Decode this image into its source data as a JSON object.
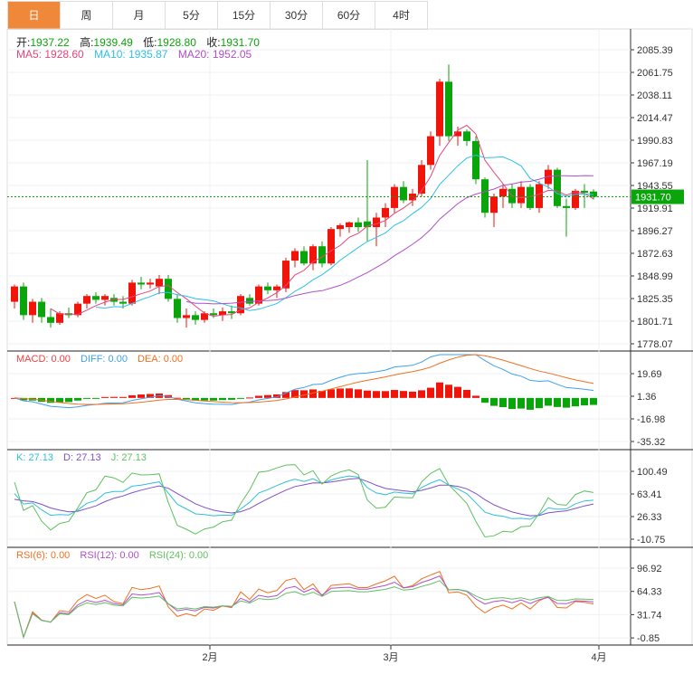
{
  "tabs": [
    {
      "label": "日",
      "active": true
    },
    {
      "label": "周"
    },
    {
      "label": "月"
    },
    {
      "label": "5分"
    },
    {
      "label": "15分"
    },
    {
      "label": "30分"
    },
    {
      "label": "60分"
    },
    {
      "label": "4时"
    }
  ],
  "ohlc_legend": {
    "open_label": "开:",
    "open": "1937.22",
    "high_label": "高:",
    "high": "1939.49",
    "low_label": "低:",
    "low": "1928.80",
    "close_label": "收:",
    "close": "1931.70"
  },
  "ma_legend": {
    "ma5": "MA5: 1928.60",
    "ma10": "MA10: 1935.87",
    "ma20": "MA20: 1952.05"
  },
  "macd_legend": {
    "macd": "MACD: 0.00",
    "diff": "DIFF: 0.00",
    "dea": "DEA: 0.00"
  },
  "kdj_legend": {
    "k": "K: 27.13",
    "d": "D: 27.13",
    "j": "J: 27.13"
  },
  "rsi_legend": {
    "rsi6": "RSI(6): 0.00",
    "rsi12": "RSI(12): 0.00",
    "rsi24": "RSI(24): 0.00"
  },
  "current_price": "1931.70",
  "colors": {
    "up": "#f0140a",
    "down": "#0aa50a",
    "ma5": "#e8457a",
    "ma10": "#2ec0e8",
    "ma20": "#b050c8",
    "tab_active": "#f0883a",
    "dif": "#3fa0f0",
    "dea": "#f07020",
    "k": "#30c0d8",
    "d": "#8050c8",
    "j": "#60c060",
    "rsi6": "#f07020",
    "rsi12": "#b050c8",
    "rsi24": "#60c060"
  },
  "chart_data": {
    "type": "candlestick",
    "price_ticks": [
      "2085.39",
      "2061.75",
      "2038.11",
      "2014.47",
      "1990.83",
      "1967.19",
      "1943.55",
      "1919.91",
      "1896.27",
      "1872.63",
      "1848.99",
      "1825.35",
      "1801.71",
      "1778.07"
    ],
    "price_range": [
      1778.07,
      2085.39
    ],
    "macd_ticks": [
      "19.69",
      "1.36",
      "-16.98",
      "-35.32"
    ],
    "macd_range": [
      -35.32,
      19.69
    ],
    "kdj_ticks": [
      "100.49",
      "63.41",
      "26.33",
      "-10.75"
    ],
    "kdj_range": [
      -10.75,
      100.49
    ],
    "rsi_ticks": [
      "96.92",
      "64.33",
      "31.74",
      "-0.85"
    ],
    "rsi_range": [
      -0.85,
      96.92
    ],
    "x_labels": [
      {
        "index": 22,
        "label": "2月"
      },
      {
        "index": 42,
        "label": "3月"
      },
      {
        "index": 65,
        "label": "4月"
      }
    ],
    "candles": [
      [
        1822,
        1840,
        1815,
        1838
      ],
      [
        1838,
        1842,
        1803,
        1808
      ],
      [
        1808,
        1825,
        1800,
        1822
      ],
      [
        1822,
        1826,
        1800,
        1806
      ],
      [
        1806,
        1815,
        1795,
        1800
      ],
      [
        1800,
        1812,
        1798,
        1810
      ],
      [
        1810,
        1816,
        1805,
        1808
      ],
      [
        1808,
        1822,
        1806,
        1820
      ],
      [
        1820,
        1830,
        1815,
        1828
      ],
      [
        1828,
        1832,
        1820,
        1824
      ],
      [
        1824,
        1830,
        1818,
        1828
      ],
      [
        1826,
        1830,
        1818,
        1822
      ],
      [
        1822,
        1828,
        1815,
        1820
      ],
      [
        1820,
        1845,
        1818,
        1842
      ],
      [
        1842,
        1848,
        1835,
        1840
      ],
      [
        1840,
        1846,
        1836,
        1842
      ],
      [
        1838,
        1850,
        1830,
        1846
      ],
      [
        1846,
        1850,
        1822,
        1825
      ],
      [
        1825,
        1830,
        1800,
        1805
      ],
      [
        1805,
        1815,
        1795,
        1808
      ],
      [
        1808,
        1812,
        1798,
        1803
      ],
      [
        1803,
        1812,
        1800,
        1810
      ],
      [
        1810,
        1815,
        1805,
        1808
      ],
      [
        1808,
        1816,
        1802,
        1812
      ],
      [
        1812,
        1818,
        1804,
        1810
      ],
      [
        1810,
        1830,
        1808,
        1828
      ],
      [
        1826,
        1830,
        1818,
        1820
      ],
      [
        1820,
        1840,
        1818,
        1838
      ],
      [
        1838,
        1842,
        1830,
        1834
      ],
      [
        1834,
        1840,
        1826,
        1838
      ],
      [
        1836,
        1868,
        1832,
        1865
      ],
      [
        1865,
        1878,
        1858,
        1875
      ],
      [
        1875,
        1880,
        1860,
        1862
      ],
      [
        1862,
        1882,
        1855,
        1880
      ],
      [
        1880,
        1885,
        1858,
        1862
      ],
      [
        1862,
        1900,
        1860,
        1898
      ],
      [
        1898,
        1904,
        1890,
        1902
      ],
      [
        1900,
        1906,
        1894,
        1905
      ],
      [
        1905,
        1910,
        1895,
        1900
      ],
      [
        1906,
        1970,
        1885,
        1900
      ],
      [
        1900,
        1915,
        1880,
        1910
      ],
      [
        1910,
        1925,
        1900,
        1920
      ],
      [
        1920,
        1945,
        1915,
        1942
      ],
      [
        1942,
        1948,
        1925,
        1928
      ],
      [
        1928,
        1940,
        1922,
        1935
      ],
      [
        1935,
        1970,
        1932,
        1965
      ],
      [
        1965,
        2000,
        1960,
        1995
      ],
      [
        1995,
        2055,
        1985,
        2052
      ],
      [
        2052,
        2070,
        1990,
        1995
      ],
      [
        1995,
        2005,
        1985,
        2000
      ],
      [
        2000,
        2002,
        1985,
        1990
      ],
      [
        1990,
        1995,
        1945,
        1950
      ],
      [
        1950,
        1952,
        1910,
        1915
      ],
      [
        1915,
        1935,
        1900,
        1932
      ],
      [
        1932,
        1945,
        1920,
        1940
      ],
      [
        1940,
        1945,
        1920,
        1925
      ],
      [
        1925,
        1948,
        1920,
        1942
      ],
      [
        1942,
        1945,
        1918,
        1920
      ],
      [
        1920,
        1948,
        1915,
        1945
      ],
      [
        1945,
        1965,
        1940,
        1960
      ],
      [
        1960,
        1962,
        1920,
        1922
      ],
      [
        1922,
        1930,
        1890,
        1920
      ],
      [
        1920,
        1940,
        1918,
        1938
      ],
      [
        1938,
        1945,
        1920,
        1936
      ],
      [
        1937.22,
        1939.49,
        1928.8,
        1931.7
      ]
    ]
  }
}
